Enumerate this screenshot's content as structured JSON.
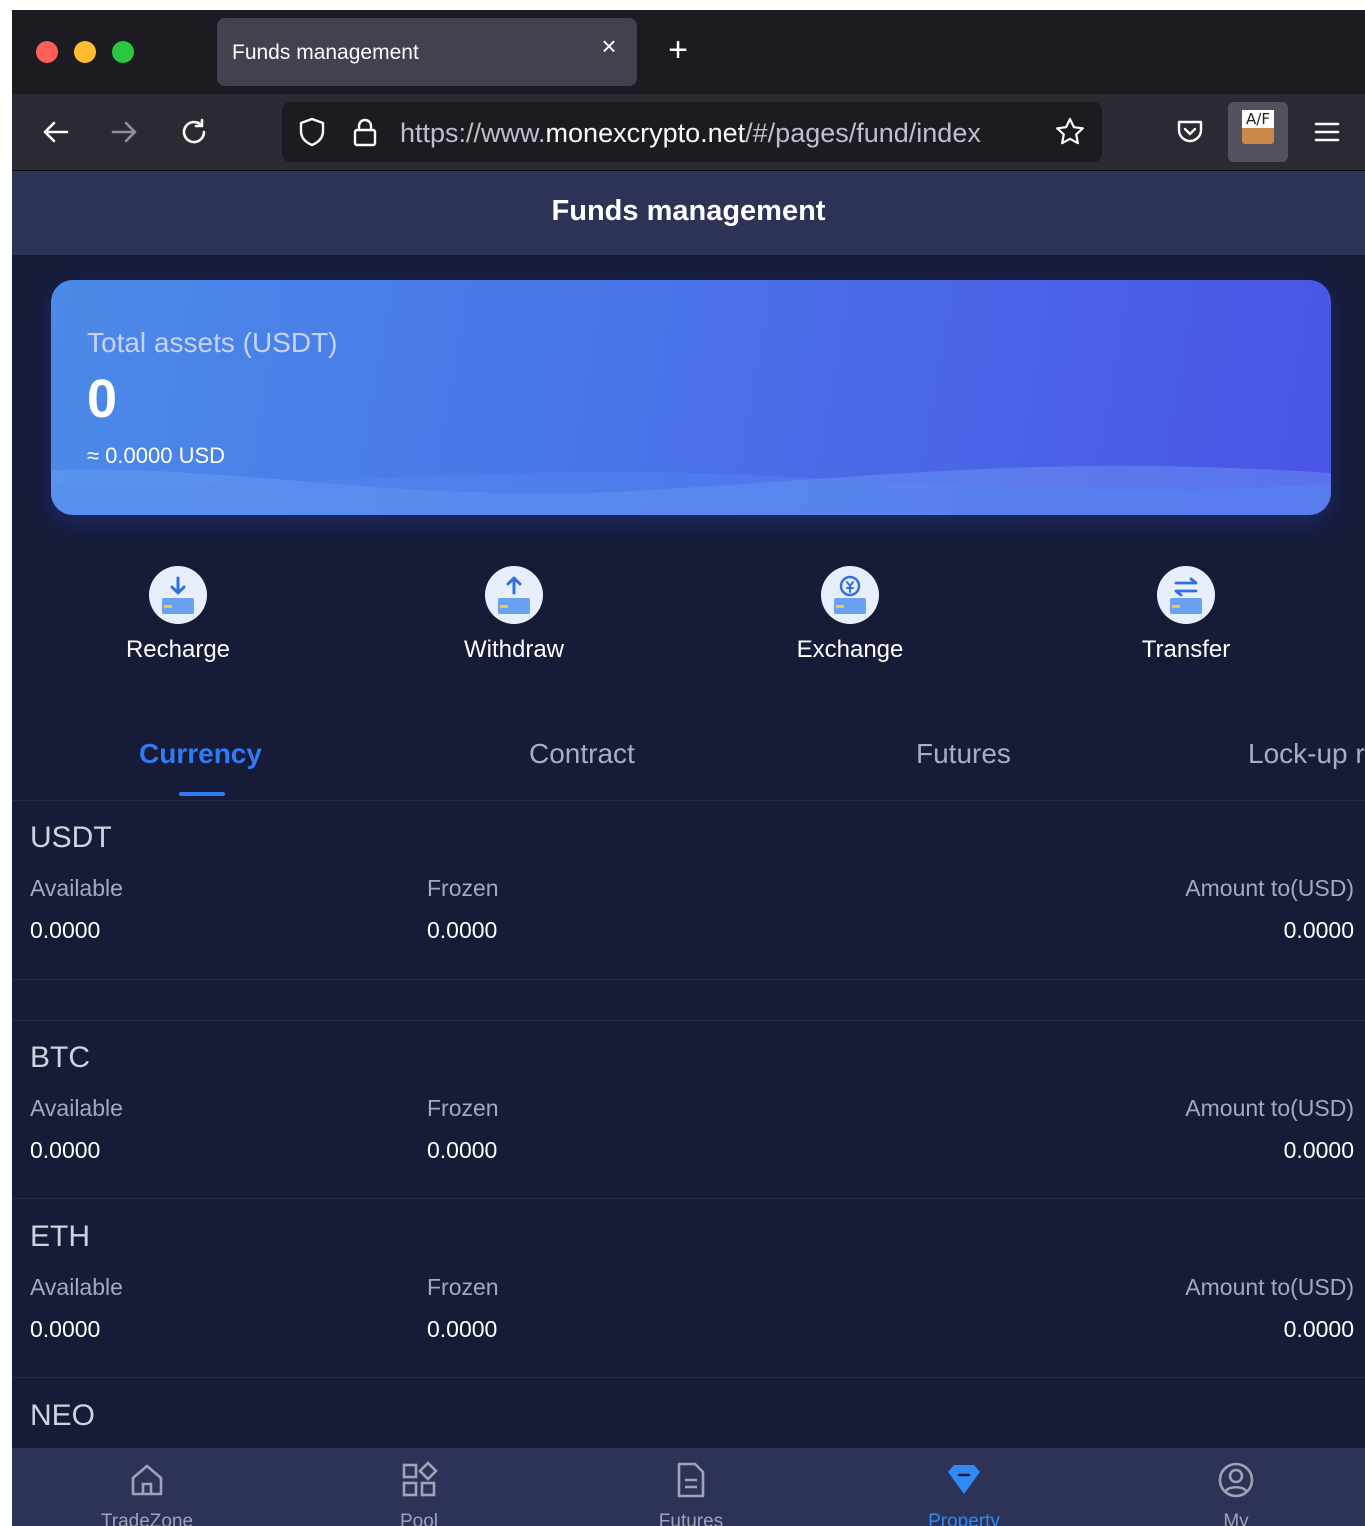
{
  "browser": {
    "tab_title": "Funds management",
    "url_prefix": "https://www.",
    "url_domain": "monexcrypto.net",
    "url_path": "/#/pages/fund/index",
    "extension_label": "A/F"
  },
  "page": {
    "title": "Funds management"
  },
  "assets": {
    "label": "Total assets (USDT)",
    "value": "0",
    "usd": "≈ 0.0000 USD"
  },
  "actions": [
    {
      "label": "Recharge",
      "icon": "download-arrow-icon"
    },
    {
      "label": "Withdraw",
      "icon": "upload-arrow-icon"
    },
    {
      "label": "Exchange",
      "icon": "yen-exchange-icon"
    },
    {
      "label": "Transfer",
      "icon": "swap-arrows-icon"
    }
  ],
  "tabs": [
    "Currency",
    "Contract",
    "Futures",
    "Lock-up r"
  ],
  "columns": {
    "available": "Available",
    "frozen": "Frozen",
    "amount": "Amount to(USD)"
  },
  "coins": [
    {
      "name": "USDT",
      "available": "0.0000",
      "frozen": "0.0000",
      "amount": "0.0000"
    },
    {
      "name": "BTC",
      "available": "0.0000",
      "frozen": "0.0000",
      "amount": "0.0000"
    },
    {
      "name": "ETH",
      "available": "0.0000",
      "frozen": "0.0000",
      "amount": "0.0000"
    },
    {
      "name": "NEO"
    }
  ],
  "bottom_nav": [
    {
      "label": "TradeZone",
      "icon": "home-icon"
    },
    {
      "label": "Pool",
      "icon": "grid-icon"
    },
    {
      "label": "Futures",
      "icon": "document-icon"
    },
    {
      "label": "Property",
      "icon": "diamond-icon",
      "active": true
    },
    {
      "label": "My",
      "icon": "user-circle-icon"
    }
  ],
  "colors": {
    "page_bg": "#161b38",
    "header_bg": "#2d3357",
    "accent": "#2f7bf5"
  }
}
